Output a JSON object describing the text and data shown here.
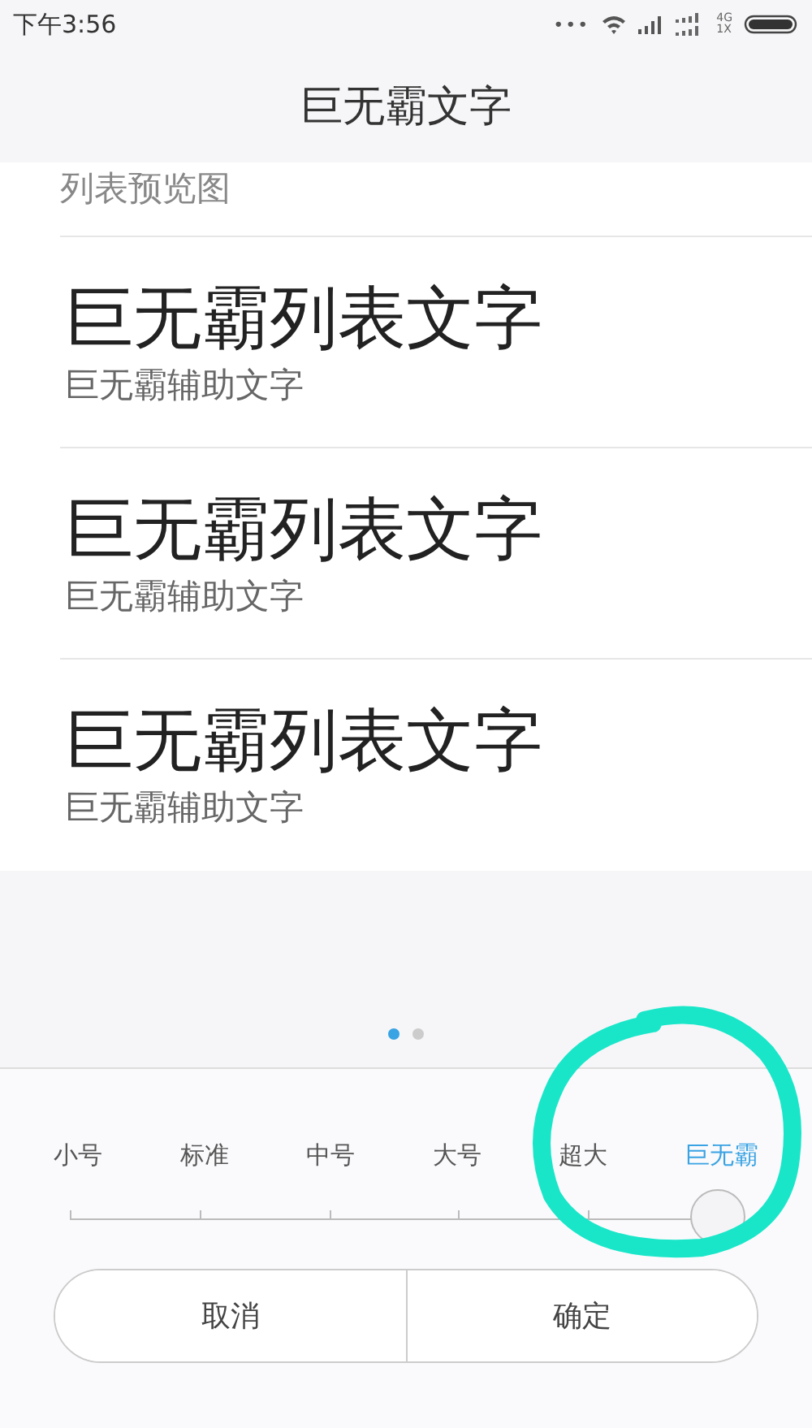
{
  "status_bar": {
    "time": "下午3:56",
    "dots": "•••",
    "network_top": "4G",
    "network_bottom": "1X"
  },
  "title": "巨无霸文字",
  "preview": {
    "header": "列表预览图",
    "items": [
      {
        "primary": "巨无霸列表文字",
        "secondary": "巨无霸辅助文字"
      },
      {
        "primary": "巨无霸列表文字",
        "secondary": "巨无霸辅助文字"
      },
      {
        "primary": "巨无霸列表文字",
        "secondary": "巨无霸辅助文字"
      }
    ]
  },
  "pages": [
    {
      "selected": true
    },
    {
      "selected": false
    }
  ],
  "sizes": [
    {
      "label": "小号",
      "selected": false
    },
    {
      "label": "标准",
      "selected": false
    },
    {
      "label": "中号",
      "selected": false
    },
    {
      "label": "大号",
      "selected": false
    },
    {
      "label": "超大",
      "selected": false
    },
    {
      "label": "巨无霸",
      "selected": true
    }
  ],
  "slider": {
    "level": 1
  },
  "buttons": [
    "取消",
    "确定"
  ],
  "annotations": [
    {
      "kind": "circle"
    }
  ]
}
